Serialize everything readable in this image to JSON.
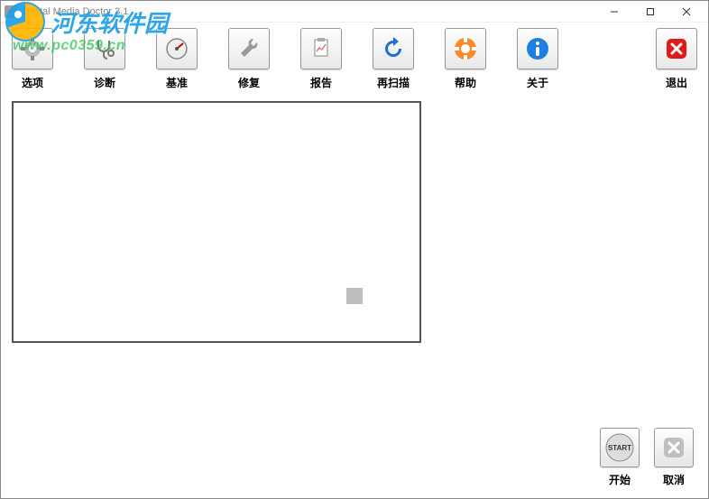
{
  "window": {
    "title": "Digital Media Doctor 3.1"
  },
  "toolbar": {
    "options": {
      "label": "选项"
    },
    "diagnose": {
      "label": "诊断"
    },
    "benchmark": {
      "label": "基准"
    },
    "repair": {
      "label": "修复"
    },
    "report": {
      "label": "报告"
    },
    "rescan": {
      "label": "再扫描"
    },
    "help": {
      "label": "帮助"
    },
    "about": {
      "label": "关于"
    },
    "exit": {
      "label": "退出"
    }
  },
  "footer": {
    "start": {
      "label": "开始",
      "btn_text": "START"
    },
    "cancel": {
      "label": "取消"
    }
  },
  "watermark": {
    "brand": "河东软件园",
    "url": "www.pc0359.cn"
  }
}
